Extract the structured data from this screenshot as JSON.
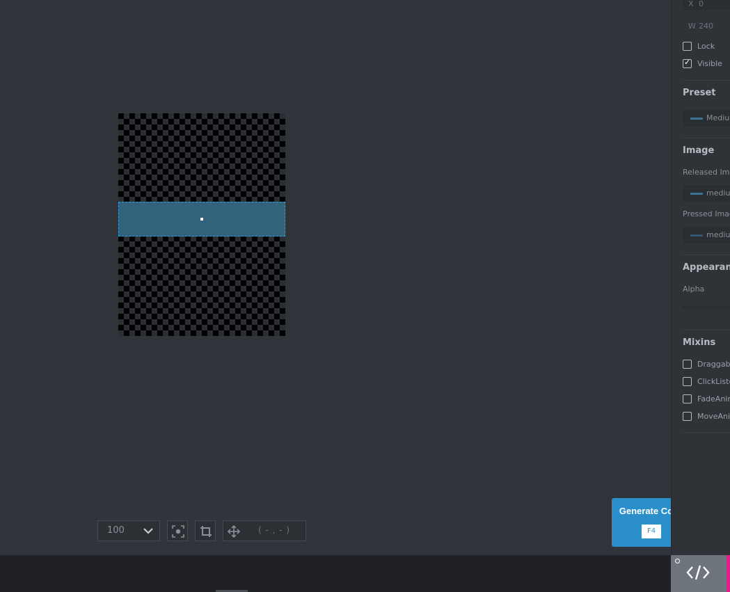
{
  "canvas": {
    "zoom_value": "100",
    "coordinate_readout": "( - , - )"
  },
  "panel": {
    "x_label": "X",
    "x_value": "0",
    "w_label": "W",
    "w_value": "240",
    "lock_label": "Lock",
    "lock_checked": false,
    "visible_label": "Visible",
    "visible_checked": true,
    "preset": {
      "title": "Preset",
      "value": "Medium"
    },
    "image": {
      "title": "Image",
      "released_label": "Released Image",
      "released_value": "medium",
      "pressed_label": "Pressed Image",
      "pressed_value": "medium"
    },
    "appearance": {
      "title": "Appearance",
      "alpha_label": "Alpha"
    },
    "mixins": {
      "title": "Mixins",
      "items": [
        {
          "label": "Draggable",
          "checked": false
        },
        {
          "label": "ClickListener",
          "checked": false
        },
        {
          "label": "FadeAnimator",
          "checked": false
        },
        {
          "label": "MoveAnimator",
          "checked": false
        }
      ]
    }
  },
  "generate_code": {
    "label": "Generate Code",
    "shortcut": "F4"
  },
  "colors": {
    "accent": "#2b8fcc",
    "widget_fill": "#33637a",
    "selection_border": "#2da6e0",
    "status_accent": "#e21e8c"
  },
  "icons": {
    "zoom_dropdown": "chevron-down-icon",
    "focus": "focus-icon",
    "crop": "crop-icon",
    "move": "move-icon",
    "code_toggle": "code-icon"
  }
}
